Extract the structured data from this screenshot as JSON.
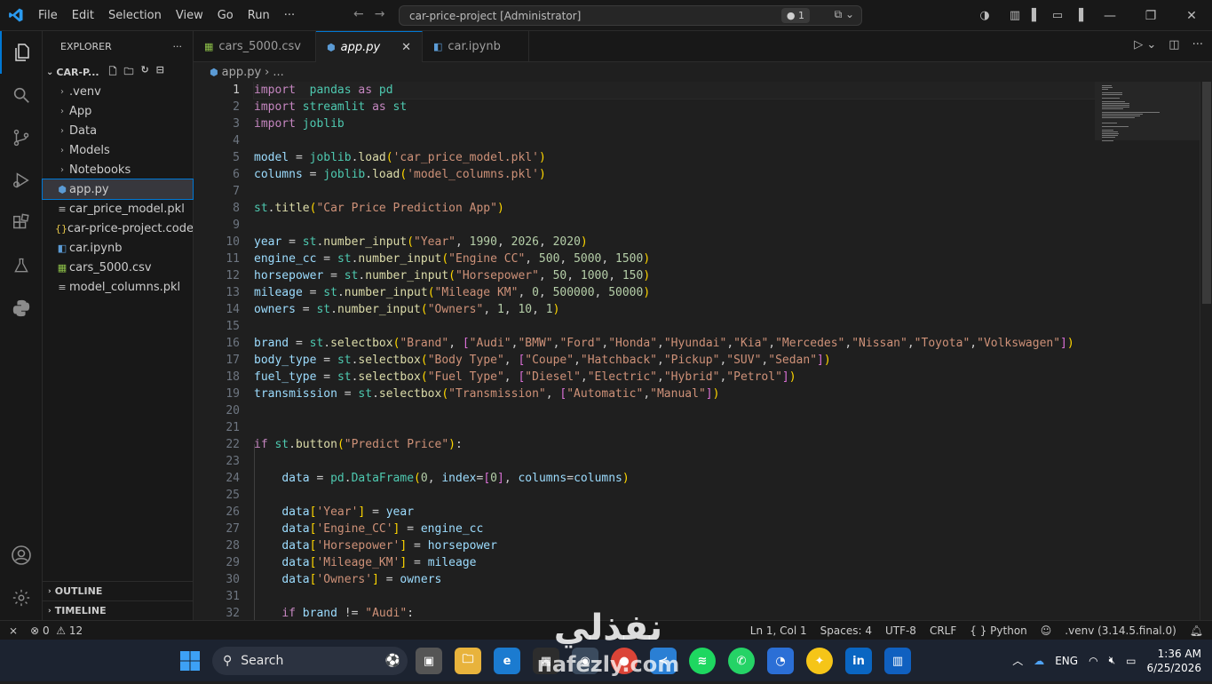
{
  "menu": [
    "File",
    "Edit",
    "Selection",
    "View",
    "Go",
    "Run",
    "···"
  ],
  "command_center": {
    "text": "car-price-project [Administrator]",
    "badge": "● 1"
  },
  "explorer": {
    "title": "EXPLORER",
    "root": "CAR-P...",
    "items": [
      {
        "label": ".venv",
        "type": "folder"
      },
      {
        "label": "App",
        "type": "folder"
      },
      {
        "label": "Data",
        "type": "folder"
      },
      {
        "label": "Models",
        "type": "folder"
      },
      {
        "label": "Notebooks",
        "type": "folder"
      },
      {
        "label": "app.py",
        "type": "py",
        "selected": true
      },
      {
        "label": "car_price_model.pkl",
        "type": "pkl"
      },
      {
        "label": "car-price-project.code...",
        "type": "json"
      },
      {
        "label": "car.ipynb",
        "type": "ipynb"
      },
      {
        "label": "cars_5000.csv",
        "type": "csv"
      },
      {
        "label": "model_columns.pkl",
        "type": "pkl"
      }
    ],
    "outline": "OUTLINE",
    "timeline": "TIMELINE"
  },
  "tabs": [
    {
      "label": "cars_5000.csv",
      "active": false
    },
    {
      "label": "app.py",
      "active": true
    },
    {
      "label": "car.ipynb",
      "active": false
    }
  ],
  "breadcrumb": {
    "file": "app.py",
    "rest": "..."
  },
  "code": [
    [
      [
        "kw",
        "import"
      ],
      [
        "",
        "  "
      ],
      [
        "mod",
        "pandas"
      ],
      [
        "",
        ""
      ],
      [
        "kw",
        " as"
      ],
      [
        "mod",
        " pd"
      ]
    ],
    [
      [
        "kw",
        "import"
      ],
      [
        "mod",
        " streamlit"
      ],
      [
        "kw",
        " as"
      ],
      [
        "mod",
        " st"
      ]
    ],
    [
      [
        "kw",
        "import"
      ],
      [
        "mod",
        " joblib"
      ]
    ],
    [],
    [
      [
        "id",
        "model"
      ],
      [
        "",
        " = "
      ],
      [
        "mod",
        "joblib"
      ],
      [
        "",
        "."
      ],
      [
        "fn",
        "load"
      ],
      [
        "br1",
        "("
      ],
      [
        "str",
        "'car_price_model.pkl'"
      ],
      [
        "br1",
        ")"
      ]
    ],
    [
      [
        "id",
        "columns"
      ],
      [
        "",
        " = "
      ],
      [
        "mod",
        "joblib"
      ],
      [
        "",
        "."
      ],
      [
        "fn",
        "load"
      ],
      [
        "br1",
        "("
      ],
      [
        "str",
        "'model_columns.pkl'"
      ],
      [
        "br1",
        ")"
      ]
    ],
    [],
    [
      [
        "mod",
        "st"
      ],
      [
        "",
        "."
      ],
      [
        "fn",
        "title"
      ],
      [
        "br1",
        "("
      ],
      [
        "str",
        "\"Car Price Prediction App\""
      ],
      [
        "br1",
        ")"
      ]
    ],
    [],
    [
      [
        "id",
        "year"
      ],
      [
        "",
        " = "
      ],
      [
        "mod",
        "st"
      ],
      [
        "",
        "."
      ],
      [
        "fn",
        "number_input"
      ],
      [
        "br1",
        "("
      ],
      [
        "str",
        "\"Year\""
      ],
      [
        "",
        ", "
      ],
      [
        "num",
        "1990"
      ],
      [
        "",
        ", "
      ],
      [
        "num",
        "2026"
      ],
      [
        "",
        ", "
      ],
      [
        "num",
        "2020"
      ],
      [
        "br1",
        ")"
      ]
    ],
    [
      [
        "id",
        "engine_cc"
      ],
      [
        "",
        " = "
      ],
      [
        "mod",
        "st"
      ],
      [
        "",
        "."
      ],
      [
        "fn",
        "number_input"
      ],
      [
        "br1",
        "("
      ],
      [
        "str",
        "\"Engine CC\""
      ],
      [
        "",
        ", "
      ],
      [
        "num",
        "500"
      ],
      [
        "",
        ", "
      ],
      [
        "num",
        "5000"
      ],
      [
        "",
        ", "
      ],
      [
        "num",
        "1500"
      ],
      [
        "br1",
        ")"
      ]
    ],
    [
      [
        "id",
        "horsepower"
      ],
      [
        "",
        " = "
      ],
      [
        "mod",
        "st"
      ],
      [
        "",
        "."
      ],
      [
        "fn",
        "number_input"
      ],
      [
        "br1",
        "("
      ],
      [
        "str",
        "\"Horsepower\""
      ],
      [
        "",
        ", "
      ],
      [
        "num",
        "50"
      ],
      [
        "",
        ", "
      ],
      [
        "num",
        "1000"
      ],
      [
        "",
        ", "
      ],
      [
        "num",
        "150"
      ],
      [
        "br1",
        ")"
      ]
    ],
    [
      [
        "id",
        "mileage"
      ],
      [
        "",
        " = "
      ],
      [
        "mod",
        "st"
      ],
      [
        "",
        "."
      ],
      [
        "fn",
        "number_input"
      ],
      [
        "br1",
        "("
      ],
      [
        "str",
        "\"Mileage KM\""
      ],
      [
        "",
        ", "
      ],
      [
        "num",
        "0"
      ],
      [
        "",
        ", "
      ],
      [
        "num",
        "500000"
      ],
      [
        "",
        ", "
      ],
      [
        "num",
        "50000"
      ],
      [
        "br1",
        ")"
      ]
    ],
    [
      [
        "id",
        "owners"
      ],
      [
        "",
        " = "
      ],
      [
        "mod",
        "st"
      ],
      [
        "",
        "."
      ],
      [
        "fn",
        "number_input"
      ],
      [
        "br1",
        "("
      ],
      [
        "str",
        "\"Owners\""
      ],
      [
        "",
        ", "
      ],
      [
        "num",
        "1"
      ],
      [
        "",
        ", "
      ],
      [
        "num",
        "10"
      ],
      [
        "",
        ", "
      ],
      [
        "num",
        "1"
      ],
      [
        "br1",
        ")"
      ]
    ],
    [],
    [
      [
        "id",
        "brand"
      ],
      [
        "",
        " = "
      ],
      [
        "mod",
        "st"
      ],
      [
        "",
        "."
      ],
      [
        "fn",
        "selectbox"
      ],
      [
        "br1",
        "("
      ],
      [
        "str",
        "\"Brand\""
      ],
      [
        "",
        ", "
      ],
      [
        "br",
        "["
      ],
      [
        "str",
        "\"Audi\""
      ],
      [
        "",
        ","
      ],
      [
        "str",
        "\"BMW\""
      ],
      [
        "",
        ","
      ],
      [
        "str",
        "\"Ford\""
      ],
      [
        "",
        ","
      ],
      [
        "str",
        "\"Honda\""
      ],
      [
        "",
        ","
      ],
      [
        "str",
        "\"Hyundai\""
      ],
      [
        "",
        ","
      ],
      [
        "str",
        "\"Kia\""
      ],
      [
        "",
        ","
      ],
      [
        "str",
        "\"Mercedes\""
      ],
      [
        "",
        ","
      ],
      [
        "str",
        "\"Nissan\""
      ],
      [
        "",
        ","
      ],
      [
        "str",
        "\"Toyota\""
      ],
      [
        "",
        ","
      ],
      [
        "str",
        "\"Volkswagen\""
      ],
      [
        "br",
        "]"
      ],
      [
        "br1",
        ")"
      ]
    ],
    [
      [
        "id",
        "body_type"
      ],
      [
        "",
        " = "
      ],
      [
        "mod",
        "st"
      ],
      [
        "",
        "."
      ],
      [
        "fn",
        "selectbox"
      ],
      [
        "br1",
        "("
      ],
      [
        "str",
        "\"Body Type\""
      ],
      [
        "",
        ", "
      ],
      [
        "br",
        "["
      ],
      [
        "str",
        "\"Coupe\""
      ],
      [
        "",
        ","
      ],
      [
        "str",
        "\"Hatchback\""
      ],
      [
        "",
        ","
      ],
      [
        "str",
        "\"Pickup\""
      ],
      [
        "",
        ","
      ],
      [
        "str",
        "\"SUV\""
      ],
      [
        "",
        ","
      ],
      [
        "str",
        "\"Sedan\""
      ],
      [
        "br",
        "]"
      ],
      [
        "br1",
        ")"
      ]
    ],
    [
      [
        "id",
        "fuel_type"
      ],
      [
        "",
        " = "
      ],
      [
        "mod",
        "st"
      ],
      [
        "",
        "."
      ],
      [
        "fn",
        "selectbox"
      ],
      [
        "br1",
        "("
      ],
      [
        "str",
        "\"Fuel Type\""
      ],
      [
        "",
        ", "
      ],
      [
        "br",
        "["
      ],
      [
        "str",
        "\"Diesel\""
      ],
      [
        "",
        ","
      ],
      [
        "str",
        "\"Electric\""
      ],
      [
        "",
        ","
      ],
      [
        "str",
        "\"Hybrid\""
      ],
      [
        "",
        ","
      ],
      [
        "str",
        "\"Petrol\""
      ],
      [
        "br",
        "]"
      ],
      [
        "br1",
        ")"
      ]
    ],
    [
      [
        "id",
        "transmission"
      ],
      [
        "",
        " = "
      ],
      [
        "mod",
        "st"
      ],
      [
        "",
        "."
      ],
      [
        "fn",
        "selectbox"
      ],
      [
        "br1",
        "("
      ],
      [
        "str",
        "\"Transmission\""
      ],
      [
        "",
        ", "
      ],
      [
        "br",
        "["
      ],
      [
        "str",
        "\"Automatic\""
      ],
      [
        "",
        ","
      ],
      [
        "str",
        "\"Manual\""
      ],
      [
        "br",
        "]"
      ],
      [
        "br1",
        ")"
      ]
    ],
    [],
    [],
    [
      [
        "kw",
        "if"
      ],
      [
        "mod",
        " st"
      ],
      [
        "",
        "."
      ],
      [
        "fn",
        "button"
      ],
      [
        "br1",
        "("
      ],
      [
        "str",
        "\"Predict Price\""
      ],
      [
        "br1",
        ")"
      ],
      [
        "",
        ":"
      ]
    ],
    [],
    [
      [
        "",
        "    "
      ],
      [
        "id",
        "data"
      ],
      [
        "",
        " = "
      ],
      [
        "mod",
        "pd"
      ],
      [
        "",
        "."
      ],
      [
        "mod",
        "DataFrame"
      ],
      [
        "br1",
        "("
      ],
      [
        "num",
        "0"
      ],
      [
        "",
        ", "
      ],
      [
        "id",
        "index"
      ],
      [
        "",
        "="
      ],
      [
        "br",
        "["
      ],
      [
        "num",
        "0"
      ],
      [
        "br",
        "]"
      ],
      [
        "",
        ", "
      ],
      [
        "id",
        "columns"
      ],
      [
        "",
        "="
      ],
      [
        "id",
        "columns"
      ],
      [
        "br1",
        ")"
      ]
    ],
    [],
    [
      [
        "",
        "    "
      ],
      [
        "id",
        "data"
      ],
      [
        "br1",
        "["
      ],
      [
        "str",
        "'Year'"
      ],
      [
        "br1",
        "]"
      ],
      [
        "",
        " = "
      ],
      [
        "id",
        "year"
      ]
    ],
    [
      [
        "",
        "    "
      ],
      [
        "id",
        "data"
      ],
      [
        "br1",
        "["
      ],
      [
        "str",
        "'Engine_CC'"
      ],
      [
        "br1",
        "]"
      ],
      [
        "",
        " = "
      ],
      [
        "id",
        "engine_cc"
      ]
    ],
    [
      [
        "",
        "    "
      ],
      [
        "id",
        "data"
      ],
      [
        "br1",
        "["
      ],
      [
        "str",
        "'Horsepower'"
      ],
      [
        "br1",
        "]"
      ],
      [
        "",
        " = "
      ],
      [
        "id",
        "horsepower"
      ]
    ],
    [
      [
        "",
        "    "
      ],
      [
        "id",
        "data"
      ],
      [
        "br1",
        "["
      ],
      [
        "str",
        "'Mileage_KM'"
      ],
      [
        "br1",
        "]"
      ],
      [
        "",
        " = "
      ],
      [
        "id",
        "mileage"
      ]
    ],
    [
      [
        "",
        "    "
      ],
      [
        "id",
        "data"
      ],
      [
        "br1",
        "["
      ],
      [
        "str",
        "'Owners'"
      ],
      [
        "br1",
        "]"
      ],
      [
        "",
        " = "
      ],
      [
        "id",
        "owners"
      ]
    ],
    [],
    [
      [
        "",
        "    "
      ],
      [
        "kw",
        "if"
      ],
      [
        "id",
        " brand"
      ],
      [
        "",
        " != "
      ],
      [
        "str",
        "\"Audi\""
      ],
      [
        "",
        ":"
      ]
    ]
  ],
  "status": {
    "errors": "0",
    "warnings": "12",
    "position": "Ln 1, Col 1",
    "spaces": "Spaces: 4",
    "encoding": "UTF-8",
    "eol": "CRLF",
    "language": "Python",
    "interpreter": ".venv (3.14.5.final.0)"
  },
  "taskbar": {
    "search": "Search",
    "lang": "ENG",
    "time": "1:36 AM",
    "date": "6/25/2026"
  },
  "watermark": {
    "arabic": "نفذلي",
    "latin": "nafezly.com"
  }
}
